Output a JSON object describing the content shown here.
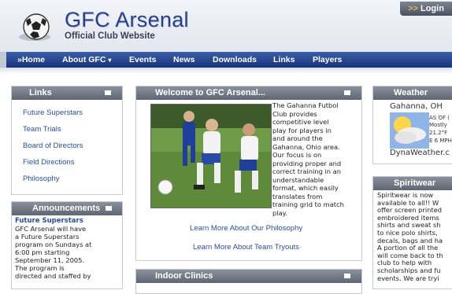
{
  "header": {
    "title": "GFC Arsenal",
    "subtitle": "Official Club Website",
    "login_arrows": ">>",
    "login_label": "Login"
  },
  "nav": {
    "items": [
      {
        "label": "»Home"
      },
      {
        "label": "About GFC"
      },
      {
        "label": "Events"
      },
      {
        "label": "News"
      },
      {
        "label": "Downloads"
      },
      {
        "label": "Links"
      },
      {
        "label": "Players"
      }
    ],
    "dropdown_glyph": "▾"
  },
  "links_panel": {
    "title": "Links",
    "items": [
      "Future Superstars",
      "Team Trials",
      "Board of Directors",
      "Field Directions",
      "Philosophy"
    ]
  },
  "announcements": {
    "title": "Announcements",
    "item_title": "Future Superstars",
    "lines": [
      "GFC Arsenal will have",
      "a Future Superstars",
      "program on Sundays at",
      "6:00 pm starting",
      "September 11, 2005.",
      "The program is",
      "directed and staffed by"
    ]
  },
  "welcome": {
    "title": "Welcome to GFC Arsenal...",
    "text_lines": [
      "The Gahanna Futbol",
      "Club provides",
      "competitive level",
      "play for players in",
      "and around the",
      "Gahanna, Ohio area.",
      "Our focus is on",
      "providing proper and",
      "correct training in an",
      "understandable",
      "format, which easily",
      "translates from",
      "training grid to match",
      "play."
    ],
    "link_philosophy": "Learn More About Our Philosophy",
    "link_tryouts": "Learn More About Team Tryouts"
  },
  "indoor": {
    "title": "Indoor Clinics"
  },
  "weather": {
    "title": "Weather",
    "city": "Gahanna, OH",
    "as_of": "AS OF (",
    "condition": "Mostly",
    "temp": "21.2°F",
    "wind": "E 6 MPH",
    "credit": "DynaWeather.c"
  },
  "spiritwear": {
    "title": "Spiritwear",
    "lines": [
      "Spiritwear is now",
      "available to all!! W",
      "offer screen printed",
      "embroidered items",
      "shirts and sweat sh",
      "to nice polo shirts,",
      "decals, bags and ha",
      "A portion of all the",
      "will come back to th",
      "club to help with",
      "scholarships and fu",
      "events.  We are tryi"
    ]
  },
  "colors": {
    "brand_blue": "#2a3f8a",
    "nav_blue": "#17337a",
    "panel_header_gray": "#6d7480",
    "link_blue": "#2a4e9a"
  }
}
